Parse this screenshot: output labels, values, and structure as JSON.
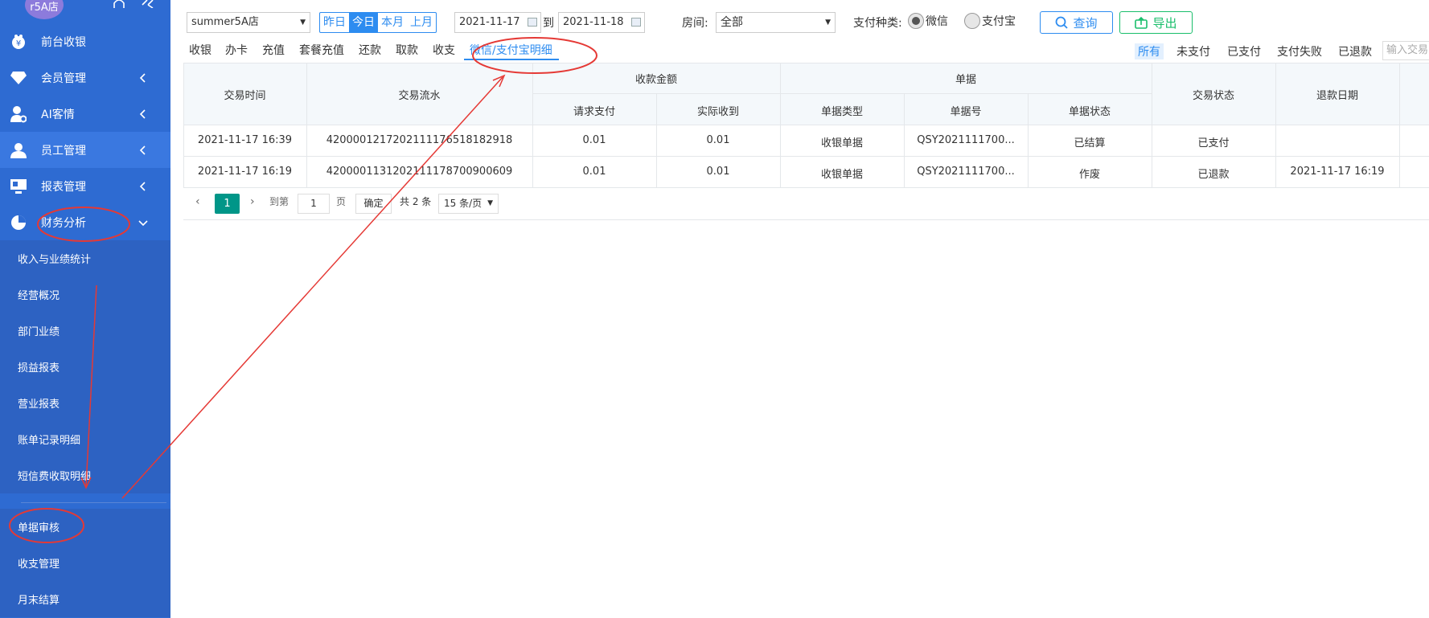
{
  "sidebar": {
    "store_badge": "r5A店",
    "bell_icon": "bell-icon",
    "collapse_icon": "double-chevron-left-icon",
    "items": [
      {
        "label": "前台收银",
        "icon": "cashier-icon"
      },
      {
        "label": "会员管理",
        "icon": "diamond-icon"
      },
      {
        "label": "AI客情",
        "icon": "user-settings-icon"
      },
      {
        "label": "员工管理",
        "icon": "user-icon"
      },
      {
        "label": "报表管理",
        "icon": "monitor-icon"
      },
      {
        "label": "财务分析",
        "icon": "pie-icon"
      }
    ],
    "subitems": [
      {
        "label": "收入与业绩统计"
      },
      {
        "label": "经营概况"
      },
      {
        "label": "部门业绩"
      },
      {
        "label": "损益报表"
      },
      {
        "label": "营业报表"
      },
      {
        "label": "账单记录明细"
      },
      {
        "label": "短信费收取明细"
      },
      {
        "label": "单据审核"
      },
      {
        "label": "收支管理"
      },
      {
        "label": "月末结算"
      }
    ]
  },
  "filters": {
    "store": "summer5A店",
    "quick_ranges": [
      "昨日",
      "今日",
      "本月",
      "上月"
    ],
    "date_from": "2021-11-17",
    "to_label": "到",
    "date_to": "2021-11-18",
    "room_label": "房间:",
    "room_value": "全部",
    "pay_type_label": "支付种类:",
    "pay_options": [
      "微信",
      "支付宝"
    ],
    "query_label": "查询",
    "export_label": "导出"
  },
  "tabs": [
    "收银",
    "办卡",
    "充值",
    "套餐充值",
    "还款",
    "取款",
    "收支",
    "微信/支付宝明细"
  ],
  "status_tabs": [
    "所有",
    "未支付",
    "已支付",
    "支付失败",
    "已退款"
  ],
  "search_placeholder": "输入交易",
  "table": {
    "group_headers": {
      "amount": "收款金额",
      "doc": "单据"
    },
    "headers": {
      "time": "交易时间",
      "serial": "交易流水",
      "requested": "请求支付",
      "received": "实际收到",
      "doc_type": "单据类型",
      "doc_no": "单据号",
      "doc_status": "单据状态",
      "trade_status": "交易状态",
      "refund_date": "退款日期"
    },
    "rows": [
      {
        "time": "2021-11-17 16:39",
        "serial": "4200001217202111176518182918",
        "requested": "0.01",
        "received": "0.01",
        "doc_type": "收银单据",
        "doc_no": "QSY2021111700...",
        "doc_status": "已结算",
        "trade_status": "已支付",
        "refund_date": ""
      },
      {
        "time": "2021-11-17 16:19",
        "serial": "4200001131202111178700900609",
        "requested": "0.01",
        "received": "0.01",
        "doc_type": "收银单据",
        "doc_no": "QSY2021111700...",
        "doc_status": "作废",
        "trade_status": "已退款",
        "refund_date": "2021-11-17 16:19"
      }
    ]
  },
  "pager": {
    "current": "1",
    "goto_label": "到第",
    "goto_value": "1",
    "page_unit": "页",
    "confirm": "确定",
    "total": "共 2 条",
    "page_size": "15 条/页"
  },
  "colors": {
    "sidebar": "#2e6bd2",
    "accent": "#2d8cf0",
    "export": "#19be6b",
    "annotation": "#e53935",
    "pager_active": "#009688"
  }
}
